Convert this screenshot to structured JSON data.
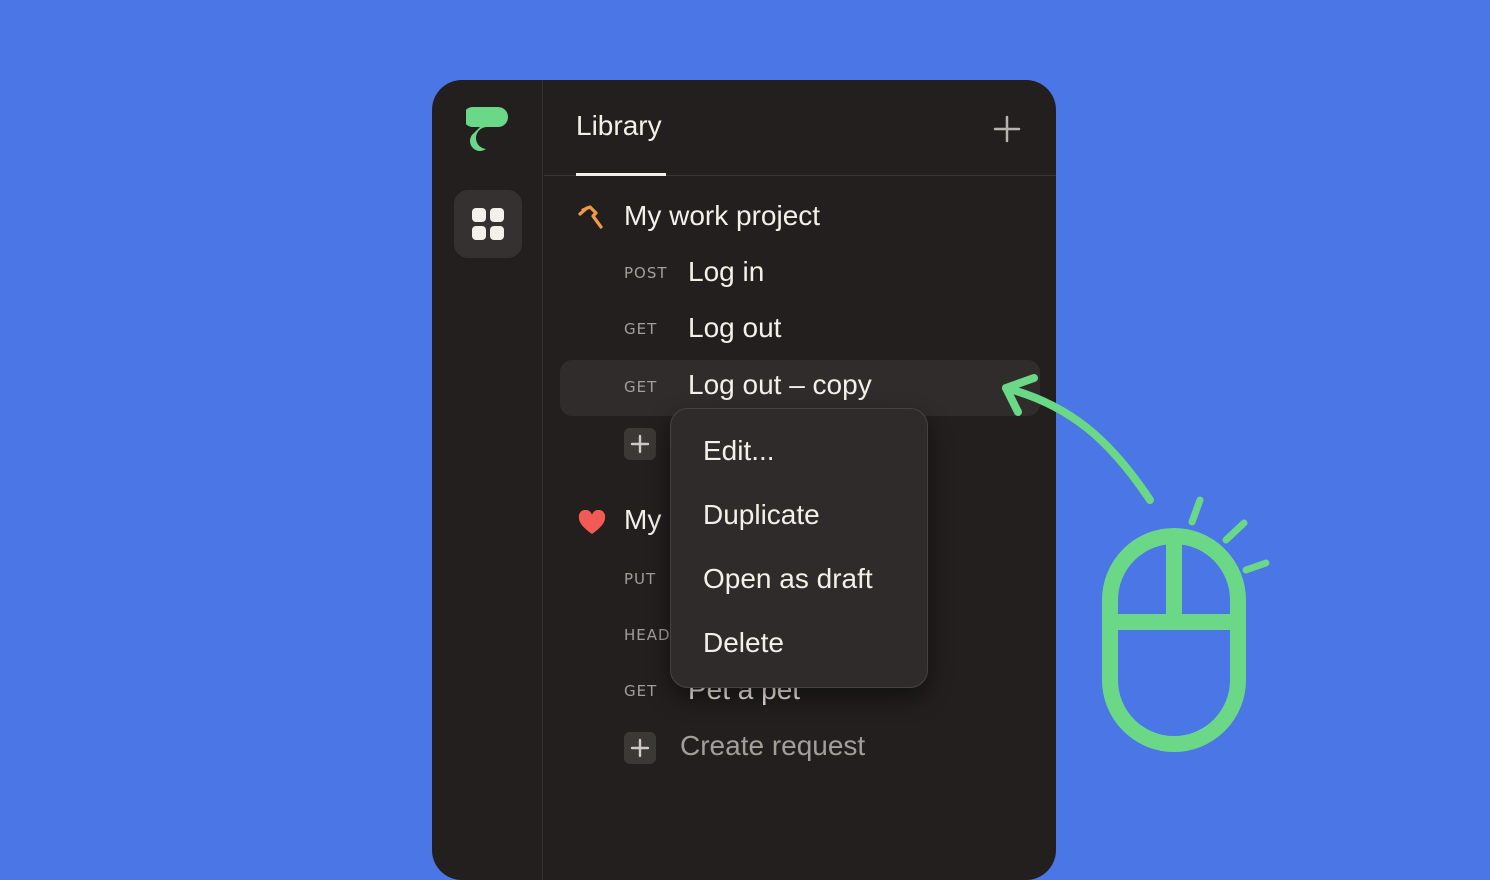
{
  "sidebar": {
    "logo_icon": "app-logo",
    "nav": [
      {
        "icon": "grid-icon"
      }
    ]
  },
  "header": {
    "tab": "Library",
    "add_icon": "plus-icon"
  },
  "library": {
    "collections": [
      {
        "icon": "hammer-icon",
        "name": "My work project",
        "requests": [
          {
            "method": "POST",
            "name": "Log in"
          },
          {
            "method": "GET",
            "name": "Log out"
          },
          {
            "method": "GET",
            "name": "Log out – copy"
          }
        ]
      },
      {
        "icon": "heart-icon",
        "name": "My",
        "requests": [
          {
            "method": "PUT",
            "name": ""
          },
          {
            "method": "HEAD",
            "name": ""
          },
          {
            "method": "GET",
            "name": "Pet a pet"
          }
        ],
        "create_label": "Create request"
      }
    ]
  },
  "context_menu": {
    "items": [
      "Edit...",
      "Duplicate",
      "Open as draft",
      "Delete"
    ]
  },
  "colors": {
    "background": "#4A76E6",
    "panel": "#221F1E",
    "accent_green": "#6BD887",
    "hammer": "#F3984A",
    "heart": "#F25A55"
  }
}
